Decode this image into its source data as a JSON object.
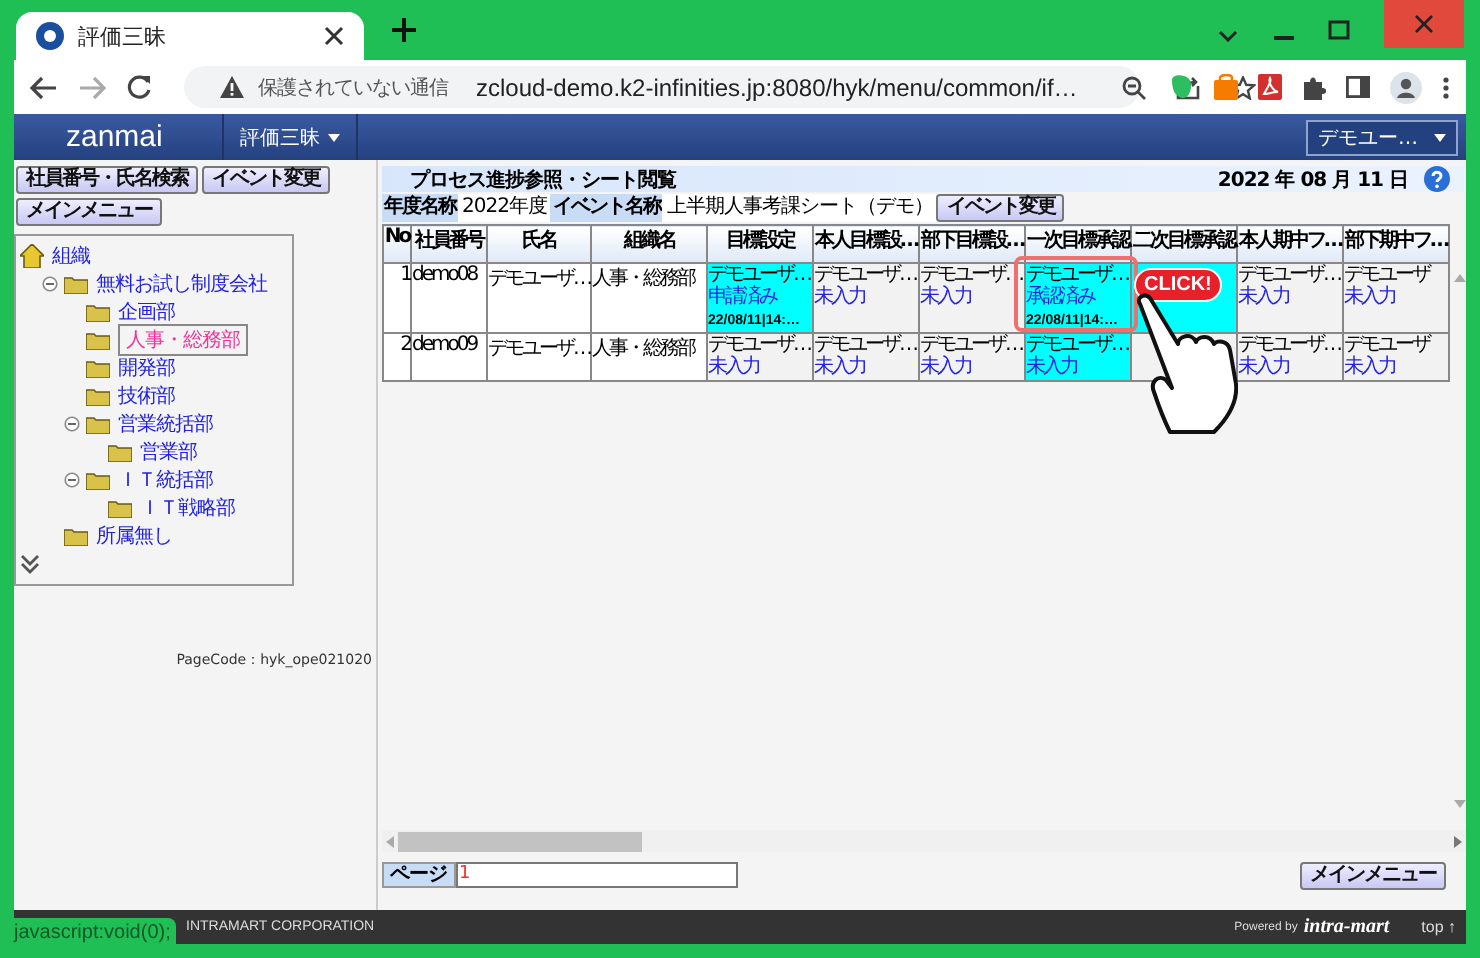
{
  "browser": {
    "tab_title": "評価三昧",
    "url_warning": "保護されていない通信",
    "url": "zcloud-demo.k2-infinities.jp:8080/hyk/menu/common/if…"
  },
  "app_header": {
    "logo": "zanmai",
    "menu": "評価三昧",
    "user": "デモユー…"
  },
  "left_buttons": [
    "社員番号・氏名検索",
    "イベント変更",
    "メインメニュー"
  ],
  "tree": {
    "label": "組織",
    "kind": "root",
    "selected": false,
    "children": [
      {
        "label": "無料お試し制度会社",
        "kind": "folder",
        "selected": false,
        "expanded": true,
        "children": [
          {
            "label": "企画部",
            "kind": "folder",
            "selected": false
          },
          {
            "label": "人事・総務部",
            "kind": "folder",
            "selected": true
          },
          {
            "label": "開発部",
            "kind": "folder",
            "selected": false
          },
          {
            "label": "技術部",
            "kind": "folder",
            "selected": false
          },
          {
            "label": "営業統括部",
            "kind": "folder",
            "selected": false,
            "expanded": true,
            "children": [
              {
                "label": "営業部",
                "kind": "folder",
                "selected": false
              }
            ]
          },
          {
            "label": "ＩＴ統括部",
            "kind": "folder",
            "selected": false,
            "expanded": true,
            "children": [
              {
                "label": "ＩＴ戦略部",
                "kind": "folder",
                "selected": false
              }
            ]
          }
        ]
      },
      {
        "label": "所属無し",
        "kind": "folder",
        "selected": false
      }
    ]
  },
  "page_code": "PageCode：hyk_ope021020",
  "panel": {
    "title": "プロセス進捗参照・シート閲覧",
    "date": "2022 年 08 月 11 日"
  },
  "filters": [
    {
      "label": "年度名称",
      "value": "2022年度"
    },
    {
      "label": "イベント名称",
      "value": "上半期人事考課シート（デモ）"
    }
  ],
  "event_button": "イベント変更",
  "table": {
    "columns": [
      "No",
      "社員番号",
      "氏名",
      "組織名",
      "目標設定",
      "本人目標設…",
      "部下目標設…",
      "一次目標承認",
      "二次目標承認",
      "本人期中フ…",
      "部下期中フ…"
    ],
    "rows": [
      {
        "no": "1",
        "id": "demo08",
        "name": "デモユーザ…",
        "org": "人事・総務部",
        "stages": [
          {
            "user": "デモユーザ…",
            "status": "申請済み",
            "time": "22/08/11|14:…",
            "highlighted": true
          },
          {
            "user": "デモユーザ…",
            "status": "未入力",
            "highlighted": false
          },
          {
            "user": "デモユーザ…",
            "status": "未入力",
            "highlighted": false
          },
          {
            "user": "デモユーザ…",
            "status": "承認済み",
            "time": "22/08/11|14:…",
            "highlighted": true
          },
          {
            "highlighted": true
          },
          {
            "user": "デモユーザ…",
            "status": "未入力",
            "highlighted": false
          },
          {
            "user": "デモユーザ",
            "status": "未入力",
            "highlighted": false
          }
        ]
      },
      {
        "no": "2",
        "id": "demo09",
        "name": "デモユーザ…",
        "org": "人事・総務部",
        "stages": [
          {
            "user": "デモユーザ…",
            "status": "未入力",
            "highlighted": false
          },
          {
            "user": "デモユーザ…",
            "status": "未入力",
            "highlighted": false
          },
          {
            "user": "デモユーザ…",
            "status": "未入力",
            "highlighted": false
          },
          {
            "user": "デモユーザ…",
            "status": "未入力",
            "highlighted": true
          },
          {
            "highlighted": false
          },
          {
            "user": "デモユーザ…",
            "status": "未入力",
            "highlighted": false
          },
          {
            "user": "デモユーザ",
            "status": "未入力",
            "highlighted": false
          }
        ]
      }
    ]
  },
  "page_label": "ページ",
  "page_value": "1",
  "main_menu_button": "メインメニュー",
  "footer": {
    "copyright": "INTRAMART CORPORATION",
    "powered": "Powered by",
    "brand": "intra-mart",
    "top": "top ↑"
  },
  "status_url": "javascript:void(0);",
  "callout": {
    "text": "CLICK!"
  }
}
